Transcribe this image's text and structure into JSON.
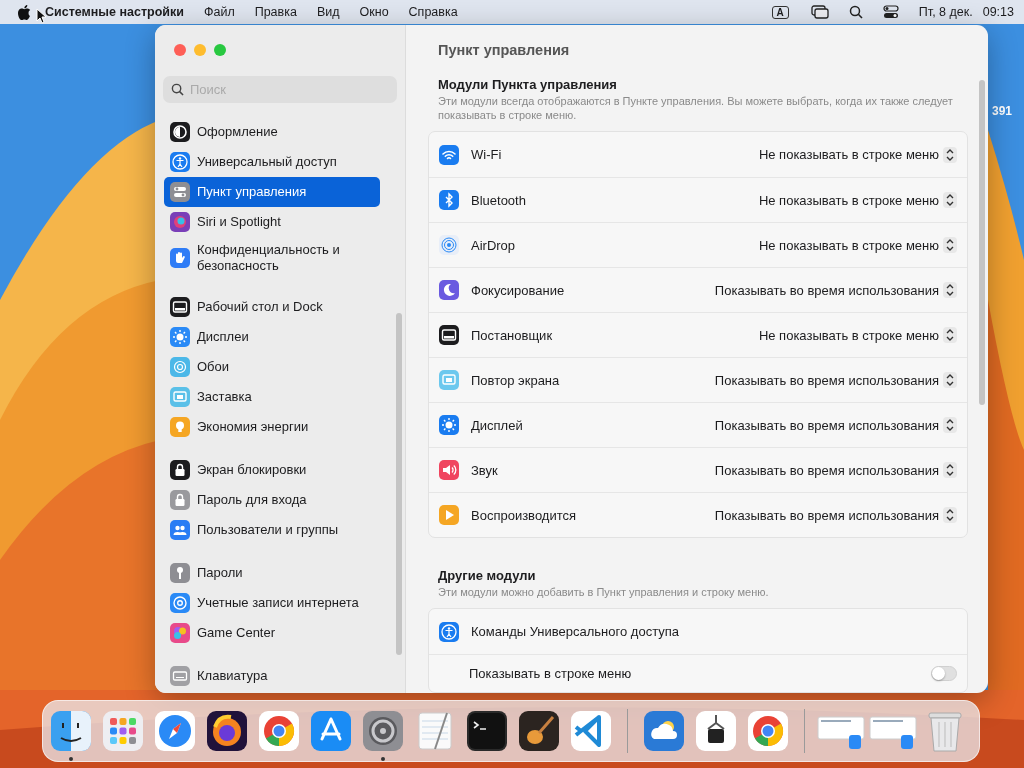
{
  "menu_bar": {
    "app_name": "Системные настройки",
    "menus": [
      "Файл",
      "Правка",
      "Вид",
      "Окно",
      "Справка"
    ],
    "input_source": "A",
    "date": "Пт, 8 дек.",
    "time": "09:13"
  },
  "desktop": {
    "edge_text": "391"
  },
  "sidebar": {
    "search": {
      "placeholder": "Поиск"
    },
    "groups": [
      [
        {
          "label": "Оформление",
          "color": "#1c1c1e",
          "selected": false
        },
        {
          "label": "Универсальный доступ",
          "color": "#1a7cf0",
          "selected": false
        },
        {
          "label": "Пункт управления",
          "color": "#8e8e93",
          "selected": true
        },
        {
          "label": "Siri и Spotlight",
          "color": "#7a3fb8",
          "selected": false
        },
        {
          "label": "Конфиденциальность и безопасность",
          "color": "#2f7cf6",
          "selected": false
        }
      ],
      [
        {
          "label": "Рабочий стол и Dock",
          "color": "#1c1c1e",
          "selected": false
        },
        {
          "label": "Дисплеи",
          "color": "#2a8af6",
          "selected": false
        },
        {
          "label": "Обои",
          "color": "#4cb8e8",
          "selected": false
        },
        {
          "label": "Заставка",
          "color": "#5ac0e8",
          "selected": false
        },
        {
          "label": "Экономия энергии",
          "color": "#f5a623",
          "selected": false
        }
      ],
      [
        {
          "label": "Экран блокировки",
          "color": "#1c1c1e",
          "selected": false
        },
        {
          "label": "Пароль для входа",
          "color": "#9a9a9e",
          "selected": false
        },
        {
          "label": "Пользователи и группы",
          "color": "#2a7df4",
          "selected": false
        }
      ],
      [
        {
          "label": "Пароли",
          "color": "#8e8e93",
          "selected": false
        },
        {
          "label": "Учетные записи интернета",
          "color": "#2a8af6",
          "selected": false
        },
        {
          "label": "Game Center",
          "color": "#e84a8a",
          "selected": false
        }
      ],
      [
        {
          "label": "Клавиатура",
          "color": "#a0a0a4",
          "selected": false
        }
      ]
    ]
  },
  "content": {
    "title": "Пункт управления",
    "modules_section": {
      "title": "Модули Пункта управления",
      "description": "Эти модули всегда отображаются в Пункте управления. Вы можете выбрать, когда их также следует показывать в строке меню.",
      "rows": [
        {
          "label": "Wi-Fi",
          "value": "Не показывать в строке меню",
          "color": "#1a7cf0"
        },
        {
          "label": "Bluetooth",
          "value": "Не показывать в строке меню",
          "color": "#1a7cf0"
        },
        {
          "label": "AirDrop",
          "value": "Не показывать в строке меню",
          "color": "#e8eef8"
        },
        {
          "label": "Фокусирование",
          "value": "Показывать во время использования",
          "color": "#6a5ae0"
        },
        {
          "label": "Постановщик",
          "value": "Не показывать в строке меню",
          "color": "#1c1c1e"
        },
        {
          "label": "Повтор экрана",
          "value": "Показывать во время использования",
          "color": "#6cc8ee"
        },
        {
          "label": "Дисплей",
          "value": "Показывать во время использования",
          "color": "#1a7cf0"
        },
        {
          "label": "Звук",
          "value": "Показывать во время использования",
          "color": "#f0455f"
        },
        {
          "label": "Воспроизводится",
          "value": "Показывать во время использования",
          "color": "#f5a623"
        }
      ]
    },
    "other_section": {
      "title": "Другие модули",
      "description": "Эти модули можно добавить в Пункт управления и строку меню.",
      "rows": [
        {
          "label": "Команды Универсального доступа",
          "color": "#1a7cf0",
          "option": {
            "label": "Показывать в строке меню",
            "on": false
          }
        }
      ]
    }
  },
  "dock": {
    "items": [
      {
        "kind": "app",
        "running": true
      },
      {
        "kind": "app",
        "running": false
      },
      {
        "kind": "app",
        "running": false
      },
      {
        "kind": "app",
        "running": false
      },
      {
        "kind": "app",
        "running": false
      },
      {
        "kind": "app",
        "running": false
      },
      {
        "kind": "app",
        "running": true
      },
      {
        "kind": "app",
        "running": false
      },
      {
        "kind": "app",
        "running": false
      },
      {
        "kind": "app",
        "running": false
      },
      {
        "kind": "app",
        "running": false
      },
      {
        "kind": "separator"
      },
      {
        "kind": "app",
        "running": false
      },
      {
        "kind": "app",
        "running": false
      },
      {
        "kind": "app",
        "running": false
      },
      {
        "kind": "separator"
      },
      {
        "kind": "minimized"
      },
      {
        "kind": "minimized"
      },
      {
        "kind": "trash"
      }
    ]
  }
}
